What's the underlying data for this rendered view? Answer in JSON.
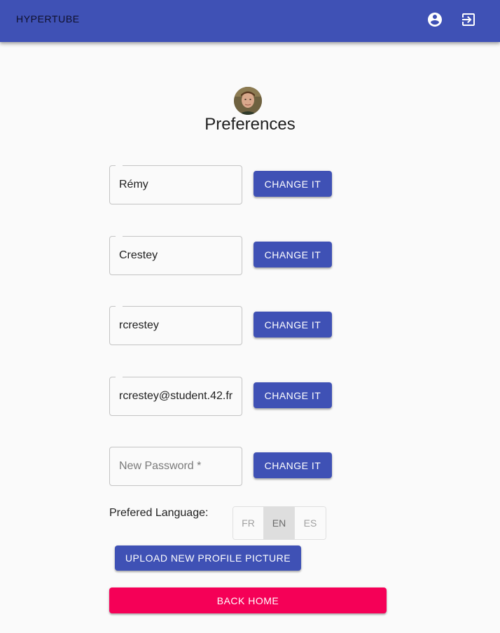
{
  "app": {
    "brand": "HYPERTUBE",
    "colors": {
      "primary": "#3f51b5",
      "secondary": "#f50057",
      "background": "#fafafa"
    }
  },
  "header": {
    "icons": [
      "account-circle-icon",
      "logout-icon"
    ]
  },
  "page": {
    "title": "Preferences"
  },
  "form": {
    "first_name": {
      "value": "Rémy",
      "button": "CHANGE IT"
    },
    "last_name": {
      "value": "Crestey",
      "button": "CHANGE IT"
    },
    "username": {
      "value": "rcrestey",
      "button": "CHANGE IT"
    },
    "email": {
      "value": "rcrestey@student.42.fr",
      "button": "CHANGE IT"
    },
    "password": {
      "value": "",
      "placeholder": "New Password *",
      "button": "CHANGE IT"
    }
  },
  "language": {
    "label": "Prefered Language:",
    "options": [
      "FR",
      "EN",
      "ES"
    ],
    "selected": "EN"
  },
  "actions": {
    "upload": "UPLOAD NEW PROFILE PICTURE",
    "back_home": "BACK HOME"
  }
}
